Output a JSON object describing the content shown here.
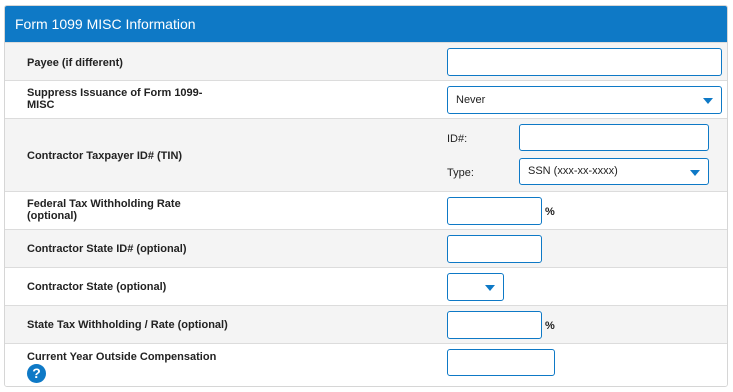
{
  "panel": {
    "title": "Form 1099 MISC Information"
  },
  "rows": {
    "payee": {
      "label": "Payee (if different)",
      "value": ""
    },
    "suppress": {
      "label_line1": "Suppress Issuance of Form 1099-",
      "label_line2": "MISC",
      "selected": "Never"
    },
    "tin": {
      "label": "Contractor Taxpayer ID# (TIN)",
      "id_label": "ID#:",
      "id_value": "",
      "type_label": "Type:",
      "type_selected": "SSN (xxx-xx-xxxx)"
    },
    "federal": {
      "label_line1": "Federal Tax Withholding Rate",
      "label_line2": "(optional)",
      "value": "",
      "unit": "%"
    },
    "state_id": {
      "label": "Contractor State ID# (optional)",
      "value": ""
    },
    "state": {
      "label": "Contractor State (optional)",
      "selected": ""
    },
    "state_tax": {
      "label": "State Tax Withholding / Rate (optional)",
      "value": "",
      "unit": "%"
    },
    "outside_comp": {
      "label": "Current Year Outside Compensation",
      "value": "",
      "help_icon": "help-circle-icon",
      "help_glyph": "?"
    }
  },
  "colors": {
    "accent": "#0e79c6",
    "row_shade": "#f4f4f4"
  }
}
